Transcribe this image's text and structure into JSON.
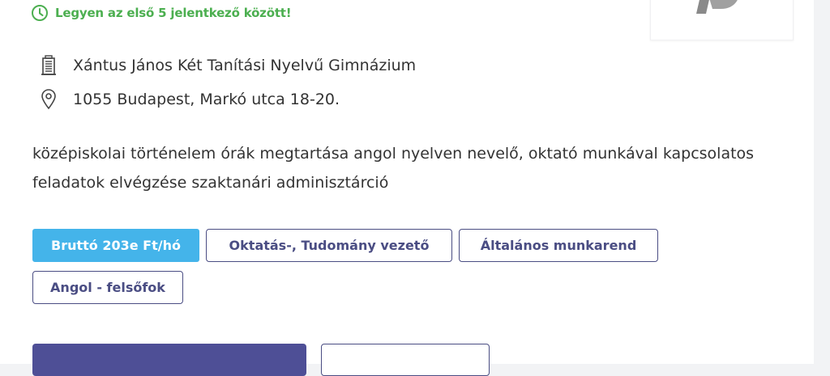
{
  "notice": {
    "text": "Legyen az első 5 jelentkező között!",
    "icon": "clock-icon",
    "color": "#4caf50"
  },
  "employer": {
    "name": "Xántus János Két Tanítási Nyelvű Gimnázium",
    "icon": "building-icon"
  },
  "location": {
    "address": "1055 Budapest, Markó utca 18-20.",
    "icon": "map-pin-icon"
  },
  "description": "középiskolai történelem órák megtartása angol nyelven nevelő, oktató munkával kapcsolatos feladatok elvégzése szaktanári adminisztárció",
  "tags": {
    "salary": "Bruttó 203e Ft/hó",
    "category": "Oktatás-, Tudomány vezető",
    "schedule": "Általános munkarend",
    "language": "Angol - felsőfok"
  },
  "colors": {
    "accent": "#4a4d83",
    "salary_badge": "#44b4ea",
    "primary_button": "#4e4f96"
  }
}
